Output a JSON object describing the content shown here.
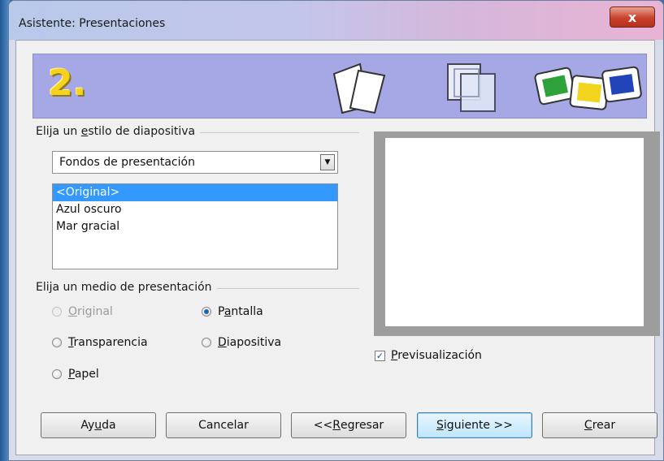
{
  "window": {
    "title": "Asistente: Presentaciones",
    "close_glyph": "x"
  },
  "banner": {
    "step": "2.",
    "icons": [
      "slides-stack-icon",
      "frames-layout-icon",
      "color-slides-icon"
    ]
  },
  "style_section": {
    "label_pre": "Elija un ",
    "label_u": "e",
    "label_post": "stilo de diapositiva",
    "combo_value": "Fondos de presentación",
    "list_items": [
      "<Original>",
      "Azul oscuro",
      "Mar gracial"
    ],
    "selected_index": 0
  },
  "medium_section": {
    "label": "Elija un medio de presentación",
    "options": [
      {
        "u": "O",
        "rest": "riginal",
        "pre": "",
        "checked": false,
        "disabled": true
      },
      {
        "pre": "P",
        "u": "a",
        "rest": "ntalla",
        "checked": true,
        "disabled": false
      },
      {
        "u": "T",
        "rest": "ransparencia",
        "pre": "",
        "checked": false,
        "disabled": false
      },
      {
        "u": "D",
        "rest": "iapositiva",
        "pre": "",
        "checked": false,
        "disabled": false
      },
      {
        "u": "P",
        "rest": "apel",
        "pre": "",
        "checked": false,
        "disabled": false
      }
    ]
  },
  "preview": {
    "checkbox_u": "P",
    "checkbox_rest": "revisualización",
    "checked": true
  },
  "buttons": {
    "help": {
      "pre": "Ay",
      "u": "u",
      "rest": "da"
    },
    "cancel": {
      "label": "Cancelar"
    },
    "back": {
      "pre": "<< ",
      "u": "R",
      "rest": "egresar"
    },
    "next": {
      "pre": "",
      "u": "S",
      "rest": "iguiente >>"
    },
    "create": {
      "pre": "",
      "u": "C",
      "rest": "rear"
    }
  },
  "colors": {
    "selection": "#3399ff",
    "banner": "#a6a8e6",
    "preview_frame": "#9d9d9d"
  }
}
